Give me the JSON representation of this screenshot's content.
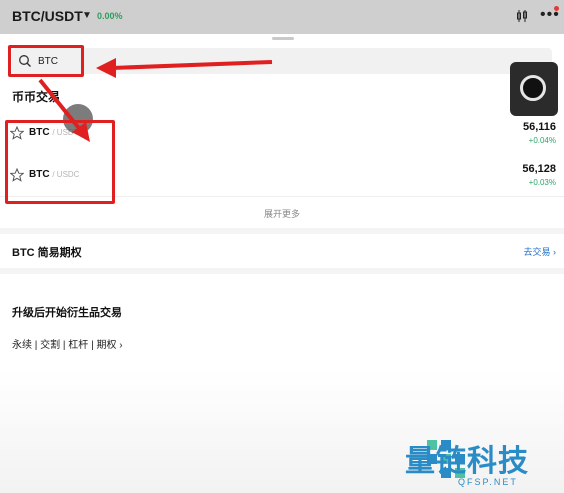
{
  "header": {
    "pair": "BTC/USDT",
    "change": "0.00%"
  },
  "search": {
    "value": "BTC"
  },
  "spot": {
    "title": "币币交易",
    "items": [
      {
        "symbol": "BTC",
        "quote": "/ USDT",
        "price": "56,116",
        "change": "+0.04%"
      },
      {
        "symbol": "BTC",
        "quote": "/ USDC",
        "price": "56,128",
        "change": "+0.03%"
      }
    ],
    "expand_label": "展开更多"
  },
  "options": {
    "title": "BTC 简易期权",
    "action": "去交易 ›"
  },
  "upgrade": {
    "title": "升级后开始衍生品交易",
    "links": "永续 | 交割 | 杠杆 | 期权 ›"
  },
  "watermark": {
    "text": "量链科技",
    "url": "QFSP.NET"
  },
  "colors": {
    "positive": "#2ea66a",
    "link": "#1f6fd1",
    "annotation": "#e02020",
    "watermark": "#2a8cc7"
  }
}
